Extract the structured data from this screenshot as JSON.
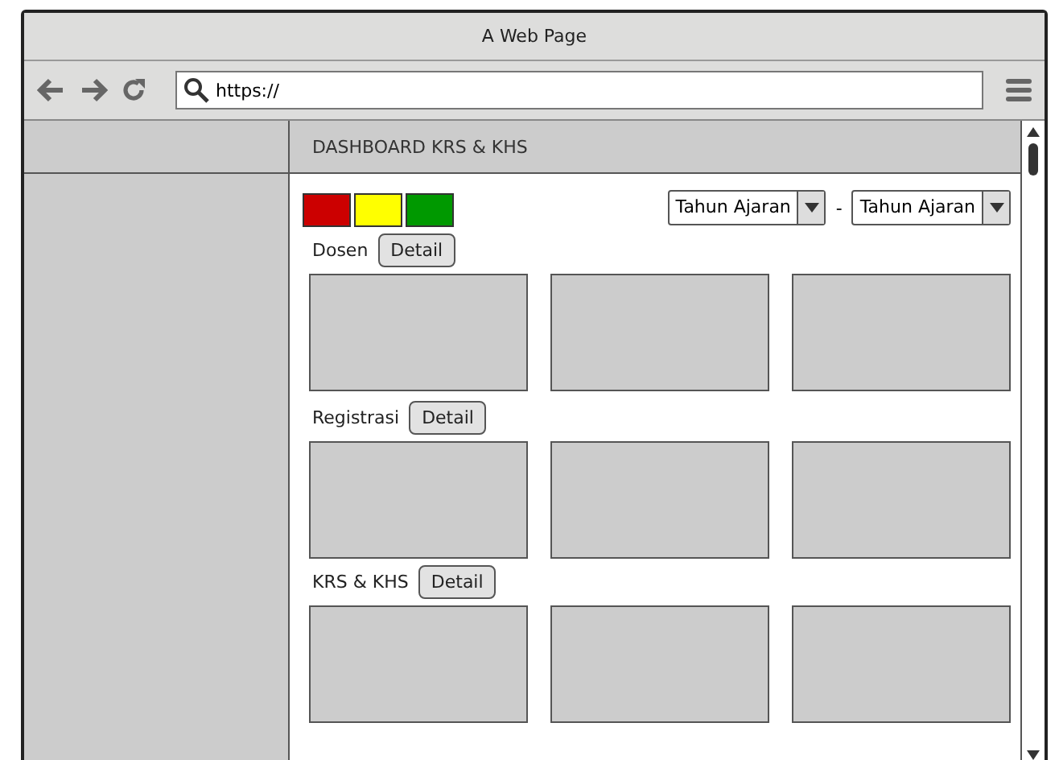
{
  "window": {
    "title": "A Web Page"
  },
  "address_bar": {
    "value": "https://"
  },
  "page": {
    "header": "DASHBOARD KRS & KHS",
    "legend": [
      {
        "color": "#cc0000"
      },
      {
        "color": "#ffff00"
      },
      {
        "color": "#009900"
      }
    ],
    "year_from": {
      "value": "Tahun Ajaran"
    },
    "separator": "-",
    "year_to": {
      "value": "Tahun Ajaran"
    },
    "sections": [
      {
        "label": "Dosen",
        "button": "Detail",
        "panels": [
          {
            "kind": "placeholder"
          },
          {
            "kind": "placeholder"
          },
          {
            "kind": "placeholder"
          }
        ]
      },
      {
        "label": "Registrasi",
        "button": "Detail",
        "panels": [
          {
            "kind": "placeholder"
          },
          {
            "kind": "placeholder"
          },
          {
            "kind": "placeholder"
          }
        ]
      },
      {
        "label": "KRS & KHS",
        "button": "Detail",
        "panels": [
          {
            "kind": "placeholder"
          },
          {
            "kind": "placeholder"
          },
          {
            "kind": "placeholder"
          }
        ]
      }
    ]
  }
}
